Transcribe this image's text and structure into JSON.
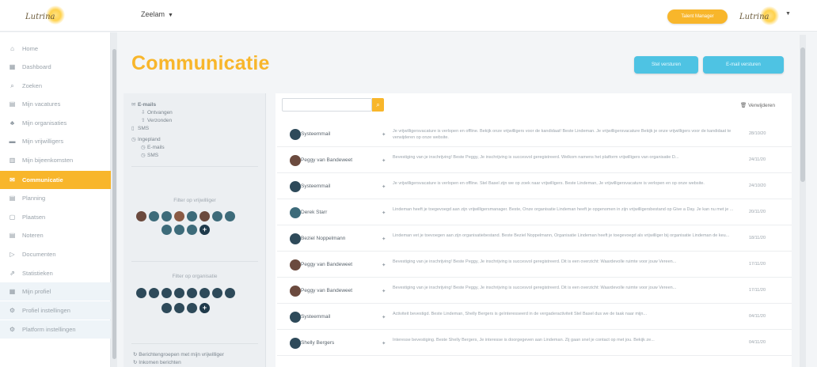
{
  "topbar": {
    "logo_text": "Lutrina",
    "org_select": "Zeelam",
    "top_button": "Talent Manager",
    "logo2_text": "Lutrina"
  },
  "sidebar": {
    "items": [
      {
        "label": "Home",
        "icon": "home-icon",
        "glyph": "⌂"
      },
      {
        "label": "Dashboard",
        "icon": "dashboard-icon",
        "glyph": "▦"
      },
      {
        "label": "Zoeken",
        "icon": "search-icon",
        "glyph": "⌕"
      },
      {
        "label": "Mijn vacatures",
        "icon": "briefcase-icon",
        "glyph": "▤"
      },
      {
        "label": "Mijn organisaties",
        "icon": "people-icon",
        "glyph": "♣"
      },
      {
        "label": "Mijn vrijwilligers",
        "icon": "id-card-icon",
        "glyph": "▬"
      },
      {
        "label": "Mijn bijeenkomsten",
        "icon": "calendar-icon",
        "glyph": "▥"
      },
      {
        "label": "Communicatie",
        "icon": "chat-icon",
        "glyph": "✉"
      },
      {
        "label": "Planning",
        "icon": "planning-icon",
        "glyph": "▤"
      },
      {
        "label": "Plaatsen",
        "icon": "document-icon",
        "glyph": "▢"
      },
      {
        "label": "Noteren",
        "icon": "note-icon",
        "glyph": "▤"
      },
      {
        "label": "Documenten",
        "icon": "folder-icon",
        "glyph": "▷"
      },
      {
        "label": "Statistieken",
        "icon": "chart-icon",
        "glyph": "⇗"
      },
      {
        "label": "Mijn profiel",
        "icon": "profile-icon",
        "glyph": "▦"
      },
      {
        "label": "Profiel instellingen",
        "icon": "settings-icon",
        "glyph": "⚙"
      },
      {
        "label": "Platform instellingen",
        "icon": "gear-icon",
        "glyph": "⚙"
      }
    ]
  },
  "main": {
    "title": "Communicatie",
    "button_new_group": "Stel versturen",
    "button_new_mail": "E-mail versturen"
  },
  "folders": {
    "emails_label": "E-mails",
    "inbox_label": "Ontvangen",
    "sent_label": "Verzonden",
    "sms_label": "SMS",
    "scheduled_label": "Ingepland",
    "scheduled_emails_label": "E-mails",
    "scheduled_sms_label": "SMS",
    "filter_volunteers_label": "Filter op vrijwilliger",
    "filter_orgs_label": "Filter op organisatie",
    "footer_link_1": "Berichtengroepen met mijn vrijwilliger",
    "footer_link_2": "Inkomen berichten"
  },
  "list": {
    "search_placeholder": "",
    "remove_label": "Verwijderen",
    "messages": [
      {
        "sender": "Systeemmail",
        "preview": "Je vrijwilligersvacature is verlopen en offline. Bekijk onze vrijwilligers voor de kandidaat! Beste Lindeman. Je vrijwilligersvacature Bekijk je onze vrijwilligers voor de kandidaat te verwijderen op onze website.",
        "date": "28/10/20",
        "avatar": "dark"
      },
      {
        "sender": "Peggy van Bandeweet",
        "preview": "Bevestiging van je inschrijving! Beste Peggy, Je inschrijving is succesvol geregistreerd. Welkom namens het platform vrijwilligers van organisatie D...",
        "date": "24/11/20",
        "avatar": "photo"
      },
      {
        "sender": "Systeemmail",
        "preview": "Je vrijwilligersvacature is verlopen en offline. Stel Basel zijn we op zoek naar vrijwilligers. Beste Lindeman, Je vrijwilligersvacature is verlopen en op onze website.",
        "date": "24/10/20",
        "avatar": "dark"
      },
      {
        "sender": "Derek Starr",
        "preview": "Lindeman heeft je toegevoegd aan zijn vrijwilligersmanager. Beste, Onze organisatie Lindeman heeft je opgenomen in zijn vrijwilligersbestand op Give a Day. Je kan nu met je ...",
        "date": "20/11/20",
        "avatar": "teal"
      },
      {
        "sender": "Beziel Noppelmann",
        "preview": "Lindeman vet je toevoegen aan zijn organisatiebestand. Beste Beziel Noppelmann, Organisatie Lindeman heeft je toegevoegd als vrijwilliger bij organisatie Lindeman de keu...",
        "date": "18/11/20",
        "avatar": "dark"
      },
      {
        "sender": "Peggy van Bandeweet",
        "preview": "Bevestiging van je inschrijving! Beste Peggy, Je inschrijving is succesvol geregistreerd. Dit is een overzicht: Waardevolle ruimte voor jouw Vereen...",
        "date": "17/11/20",
        "avatar": "photo"
      },
      {
        "sender": "Peggy van Bandeweet",
        "preview": "Bevestiging van je inschrijving! Beste Peggy, Je inschrijving is succesvol geregistreerd. Dit is een overzicht: Waardevolle ruimte voor jouw Vereen...",
        "date": "17/11/20",
        "avatar": "photo"
      },
      {
        "sender": "Systeemmail",
        "preview": "Activiteit bevestigd. Beste Lindeman, Shelly Bergers is geïnteresseerd in de vergaderactiviteit Stel Basel dus we de taak naar mijn...",
        "date": "04/11/20",
        "avatar": "dark"
      },
      {
        "sender": "Shelly Bergers",
        "preview": "Interesse bevestiging. Beste Shelly Bergers, Je interesse is doorgegeven aan Lindeman. Zij gaan snel je contact op met jou. Bekijk ze...",
        "date": "04/11/20",
        "avatar": "dark"
      }
    ]
  },
  "colors": {
    "accent": "#f8b62b",
    "cyan_button": "#4ec3e3",
    "dark_avatar": "#2e4a5a"
  }
}
